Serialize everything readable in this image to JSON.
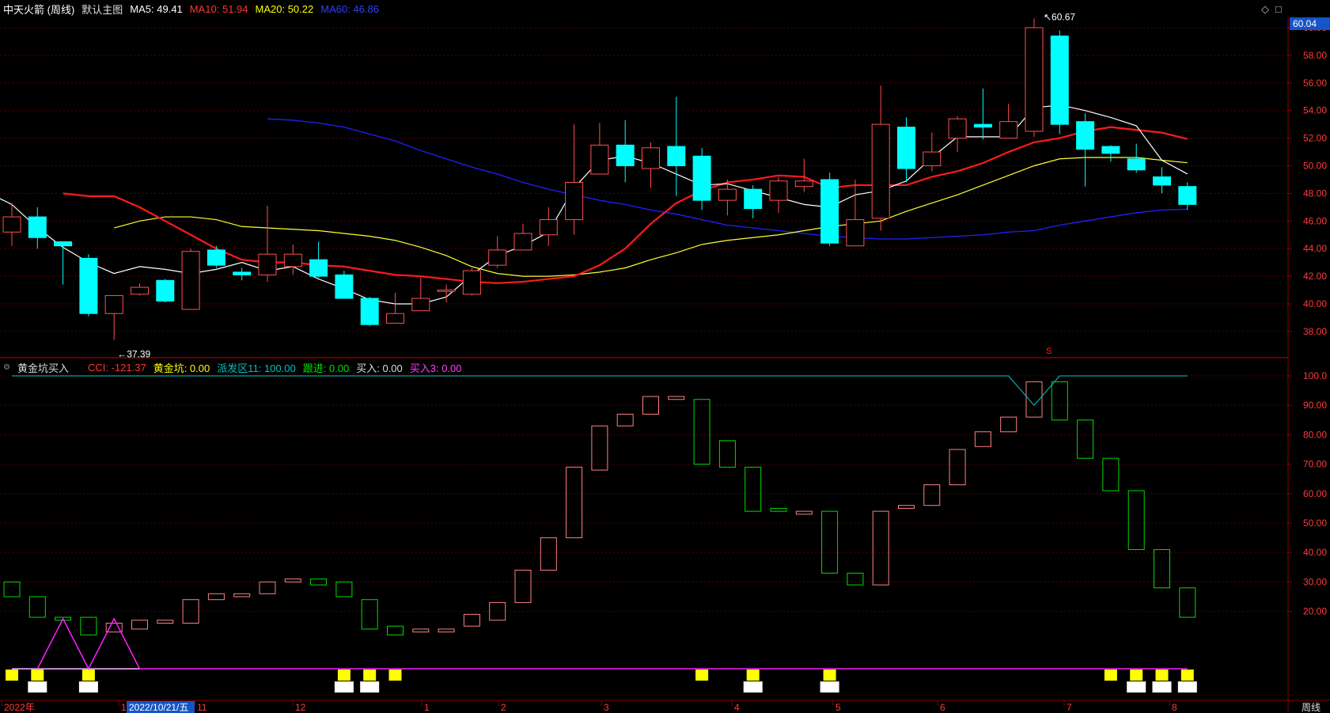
{
  "header": {
    "stock_name": "中天火箭 (周线)",
    "template": "默认主图",
    "ma": [
      {
        "label": "MA5: 49.41",
        "color": "#ffffff"
      },
      {
        "label": "MA10: 51.94",
        "color": "#ff3333"
      },
      {
        "label": "MA20: 50.22",
        "color": "#ffff00"
      },
      {
        "label": "MA60: 46.86",
        "color": "#3040ff"
      }
    ],
    "window_icons": [
      "diamond-icon",
      "square-icon"
    ]
  },
  "indicator": {
    "name": "黄金坑买入",
    "values": [
      {
        "label": "CCI: -121.37",
        "color": "#ff3333"
      },
      {
        "label": "黄金坑: 0.00",
        "color": "#ffff00"
      },
      {
        "label": "派发区11: 100.00",
        "color": "#00c0c0"
      },
      {
        "label": "跟进: 0.00",
        "color": "#00e000"
      },
      {
        "label": "买入: 0.00",
        "color": "#dddddd"
      },
      {
        "label": "买入3: 0.00",
        "color": "#ff40ff"
      }
    ]
  },
  "price_axis": {
    "labels": [
      "60.00",
      "58.00",
      "56.00",
      "54.00",
      "52.00",
      "50.00",
      "48.00",
      "46.00",
      "44.00",
      "42.00",
      "40.00",
      "38.00"
    ],
    "current_price": "60.04"
  },
  "ind_axis": {
    "labels": [
      "100.0",
      "90.00",
      "80.00",
      "70.00",
      "60.00",
      "50.00",
      "40.00",
      "30.00",
      "20.00"
    ]
  },
  "annotations": {
    "high": "60.67",
    "low": "37.39",
    "marker": "S"
  },
  "x_axis": {
    "labels": [
      "2022年",
      "10",
      "11",
      "12",
      "1",
      "2",
      "3",
      "4",
      "5",
      "6",
      "7",
      "8"
    ],
    "cursor_date": "2022/10/21/五",
    "period": "周线"
  },
  "colors": {
    "up": "#ff4f4f",
    "down": "#00ffff",
    "ma5": "#ffffff",
    "ma10": "#ff1a1a",
    "ma20": "#ffff33",
    "ma60": "#2020ff",
    "cci_up": "#ff8080",
    "cci_down": "#00dd00",
    "zone": "#00c8c8",
    "buy3": "#ff20ff"
  },
  "chart_data": {
    "type": "candlestick",
    "period": "weekly",
    "candles": [
      [
        45.2,
        46.3,
        47.3,
        44.2
      ],
      [
        46.3,
        44.8,
        47.0,
        44.0
      ],
      [
        44.5,
        44.2,
        44.5,
        41.4
      ],
      [
        43.3,
        39.3,
        43.6,
        39.1
      ],
      [
        39.3,
        40.6,
        40.6,
        37.39
      ],
      [
        40.7,
        41.2,
        41.5,
        40.6
      ],
      [
        41.7,
        40.2,
        41.8,
        40.1
      ],
      [
        39.6,
        43.8,
        44.0,
        39.6
      ],
      [
        43.9,
        42.8,
        44.2,
        42.6
      ],
      [
        42.3,
        42.1,
        42.6,
        41.7
      ],
      [
        42.1,
        43.6,
        47.1,
        41.6
      ],
      [
        42.7,
        43.6,
        44.3,
        42.1
      ],
      [
        43.2,
        42.0,
        44.5,
        41.9
      ],
      [
        42.1,
        40.4,
        42.4,
        40.4
      ],
      [
        40.4,
        38.5,
        40.5,
        38.4
      ],
      [
        38.6,
        39.3,
        40.8,
        38.7
      ],
      [
        39.5,
        40.4,
        41.9,
        39.5
      ],
      [
        40.9,
        41.0,
        41.4,
        40.1
      ],
      [
        40.7,
        42.4,
        42.6,
        40.6
      ],
      [
        42.8,
        43.9,
        44.9,
        42.6
      ],
      [
        43.9,
        45.1,
        45.8,
        43.9
      ],
      [
        45.0,
        46.1,
        47.0,
        44.2
      ],
      [
        46.1,
        48.8,
        53.0,
        45.0
      ],
      [
        49.4,
        51.5,
        53.1,
        49.4
      ],
      [
        51.5,
        50.0,
        53.3,
        48.8
      ],
      [
        49.8,
        51.3,
        51.7,
        48.4
      ],
      [
        51.4,
        50.0,
        55.0,
        47.8
      ],
      [
        50.7,
        47.5,
        51.3,
        46.8
      ],
      [
        47.5,
        48.3,
        49.0,
        46.4
      ],
      [
        48.3,
        46.9,
        48.6,
        46.2
      ],
      [
        47.5,
        48.9,
        49.2,
        46.6
      ],
      [
        48.5,
        48.9,
        50.5,
        48.1
      ],
      [
        49.0,
        44.4,
        49.5,
        44.2
      ],
      [
        44.2,
        46.1,
        49.0,
        44.2
      ],
      [
        46.2,
        53.0,
        55.8,
        45.3
      ],
      [
        52.8,
        49.8,
        53.5,
        48.8
      ],
      [
        50.0,
        51.0,
        52.4,
        49.6
      ],
      [
        52.0,
        53.4,
        53.6,
        51.0
      ],
      [
        53.0,
        52.8,
        55.6,
        51.9
      ],
      [
        52.0,
        53.2,
        54.5,
        52.1
      ],
      [
        52.5,
        60.0,
        60.67,
        52.1
      ],
      [
        59.4,
        53.0,
        59.8,
        52.3
      ],
      [
        53.2,
        51.2,
        53.8,
        48.5
      ],
      [
        51.4,
        50.9,
        51.5,
        50.3
      ],
      [
        50.5,
        49.7,
        51.6,
        49.5
      ],
      [
        49.2,
        48.6,
        49.9,
        48.0
      ],
      [
        48.5,
        47.2,
        48.8,
        46.8
      ]
    ],
    "ma5": [
      48.1,
      47.2,
      45.5,
      44.1,
      43.0,
      42.2,
      42.7,
      42.5,
      42.2,
      42.5,
      43.0,
      42.4,
      42.7,
      41.8,
      41.1,
      40.3,
      40.0,
      40.0,
      40.5,
      42.1,
      43.5,
      44.2,
      45.2,
      48.4,
      50.4,
      50.7,
      50.2,
      49.4,
      48.6,
      48.7,
      48.2,
      47.7,
      47.2,
      47.0,
      47.9,
      48.2,
      48.9,
      50.6,
      52.1,
      52.1,
      52.1,
      54.2,
      54.4,
      54.0,
      53.5,
      52.9,
      50.4,
      49.41
    ],
    "ma10": [
      48.0,
      47.8,
      47.8,
      47.0,
      46.0,
      45.0,
      44.0,
      43.2,
      43.0,
      43.0,
      42.8,
      42.7,
      42.4,
      42.1,
      42.0,
      41.8,
      41.6,
      41.5,
      41.6,
      41.8,
      42.0,
      42.8,
      44.0,
      45.8,
      47.3,
      48.2,
      48.8,
      49.0,
      49.3,
      49.2,
      48.4,
      48.6,
      48.6,
      48.6,
      49.2,
      49.6,
      50.2,
      51.0,
      51.7,
      52.0,
      52.5,
      52.8,
      52.6,
      52.4,
      51.94
    ],
    "ma20": [
      45.5,
      46.0,
      46.3,
      46.3,
      46.1,
      45.6,
      45.5,
      45.4,
      45.3,
      45.1,
      44.9,
      44.6,
      44.1,
      43.5,
      42.7,
      42.2,
      42.0,
      42.0,
      42.1,
      42.3,
      42.6,
      43.2,
      43.7,
      44.3,
      44.6,
      44.8,
      45.0,
      45.3,
      45.6,
      45.8,
      46.0,
      46.7,
      47.3,
      47.9,
      48.6,
      49.3,
      50.0,
      50.5,
      50.6,
      50.6,
      50.6,
      50.4,
      50.22
    ],
    "ma60": [
      53.4,
      53.3,
      53.1,
      52.8,
      52.3,
      51.8,
      51.1,
      50.5,
      49.9,
      49.4,
      48.8,
      48.3,
      47.9,
      47.5,
      47.2,
      46.8,
      46.5,
      46.1,
      45.7,
      45.5,
      45.3,
      45.1,
      44.9,
      44.8,
      44.7,
      44.7,
      44.8,
      44.9,
      45.0,
      45.2,
      45.3,
      45.7,
      46.0,
      46.3,
      46.6,
      46.8,
      46.86
    ],
    "cci_boxes": [
      [
        30,
        25
      ],
      [
        25,
        18
      ],
      [
        18,
        17
      ],
      [
        18,
        12
      ],
      [
        16,
        13
      ],
      [
        17,
        14
      ],
      [
        17,
        16
      ],
      [
        24,
        16
      ],
      [
        26,
        24
      ],
      [
        26,
        25
      ],
      [
        30,
        26
      ],
      [
        31,
        30
      ],
      [
        31,
        29
      ],
      [
        30,
        25
      ],
      [
        24,
        14
      ],
      [
        15,
        12
      ],
      [
        14,
        13
      ],
      [
        14,
        13
      ],
      [
        19,
        15
      ],
      [
        23,
        17
      ],
      [
        34,
        23
      ],
      [
        45,
        34
      ],
      [
        69,
        45
      ],
      [
        83,
        68
      ],
      [
        87,
        83
      ],
      [
        93,
        87
      ],
      [
        93,
        92
      ],
      [
        92,
        70
      ],
      [
        78,
        69
      ],
      [
        69,
        54
      ],
      [
        55,
        54
      ],
      [
        54,
        53
      ],
      [
        54,
        33
      ],
      [
        33,
        29
      ],
      [
        54,
        29
      ],
      [
        56,
        55
      ],
      [
        63,
        56
      ],
      [
        75,
        63
      ],
      [
        81,
        76
      ],
      [
        86,
        81
      ],
      [
        98,
        86
      ],
      [
        98,
        85
      ],
      [
        85,
        72
      ],
      [
        72,
        61
      ],
      [
        61,
        41
      ],
      [
        41,
        28
      ],
      [
        28,
        18
      ]
    ],
    "cci_up": [
      false,
      false,
      false,
      false,
      true,
      true,
      true,
      true,
      true,
      true,
      true,
      true,
      false,
      false,
      false,
      false,
      true,
      true,
      true,
      true,
      true,
      true,
      true,
      true,
      true,
      true,
      true,
      false,
      false,
      false,
      false,
      true,
      false,
      false,
      true,
      true,
      true,
      true,
      true,
      true,
      true,
      false,
      false,
      false,
      false,
      false,
      false
    ],
    "yellow_marks": [
      0,
      1,
      3,
      13,
      14,
      15,
      27,
      29,
      32,
      43,
      44,
      45,
      46
    ],
    "white_marks": [
      1,
      3,
      13,
      14,
      29,
      32,
      44,
      45,
      46
    ],
    "buy3_peaks": [
      2,
      4
    ]
  }
}
